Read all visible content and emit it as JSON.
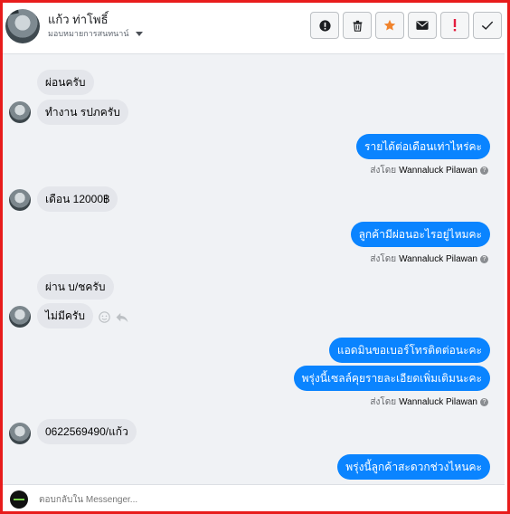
{
  "header": {
    "name": "แก้ว ท่าโพธิ์",
    "subtitle": "มอบหมายการสนทนาน์"
  },
  "actions": [
    {
      "icon": "exclamation-circle-icon",
      "color": "#1c1e21"
    },
    {
      "icon": "trash-icon",
      "color": "#1c1e21"
    },
    {
      "icon": "star-icon",
      "color": "#f0832c"
    },
    {
      "icon": "envelope-icon",
      "color": "#1c1e21"
    },
    {
      "icon": "exclamation-icon",
      "color": "#e41e3f"
    },
    {
      "icon": "check-icon",
      "color": "#1c1e21"
    }
  ],
  "messages": {
    "m1": "ผ่อนครับ",
    "m2": "ทำงาน รปภครับ",
    "m3": "รายได้ต่อเดือนเท่าไหร่คะ",
    "m4": "เดือน 12000฿",
    "m5": "ลูกค้ามีผ่อนอะไรอยู่ไหมคะ",
    "m6": "ผ่าน บ/ชครับ",
    "m7": "ไม่มีครับ",
    "m8": "แอดมินขอเบอร์โทรติดต่อนะคะ",
    "m9": "พรุ่งนี้เซลล์คุยรายละเอียดเพิ่มเติมนะคะ",
    "m10": "0622569490/แก้ว",
    "m11": "พรุ่งนี้ลูกค้าสะดวกช่วงไหนคะ"
  },
  "sent_by": {
    "prefix": "ส่งโดย",
    "agent": "Wannaluck Pilawan",
    "help": "?"
  },
  "composer": {
    "placeholder": "ตอบกลับใน Messenger..."
  },
  "colors": {
    "outgoing": "#0a84ff",
    "incoming": "#e4e6eb",
    "border": "#e81c1c"
  }
}
